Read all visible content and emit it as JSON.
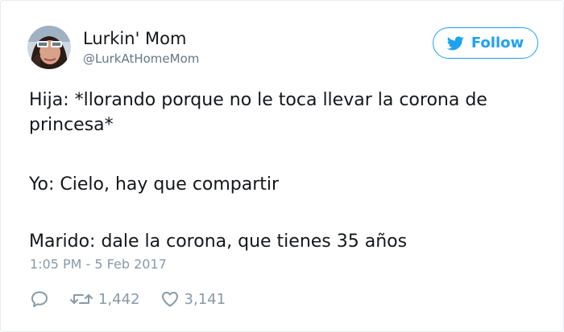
{
  "author": {
    "display_name": "Lurkin' Mom",
    "handle": "@LurkAtHomeMom"
  },
  "follow_button": {
    "label": "Follow",
    "icon": "twitter-bird-icon"
  },
  "tweet": {
    "lines": [
      "Hija: *llorando porque no le toca llevar la corona de",
      "princesa*",
      "Yo: Cielo, hay que compartir",
      "Marido: dale la corona, que tienes 35 años"
    ],
    "timestamp": "1:05 PM - 5 Feb 2017"
  },
  "actions": {
    "reply": {
      "icon": "reply-icon"
    },
    "retweet": {
      "icon": "retweet-icon",
      "count": "1,442"
    },
    "like": {
      "icon": "heart-icon",
      "count": "3,141"
    }
  },
  "colors": {
    "accent": "#1da1f2",
    "text": "#14171a",
    "muted": "#8899a6",
    "handle": "#657786"
  }
}
